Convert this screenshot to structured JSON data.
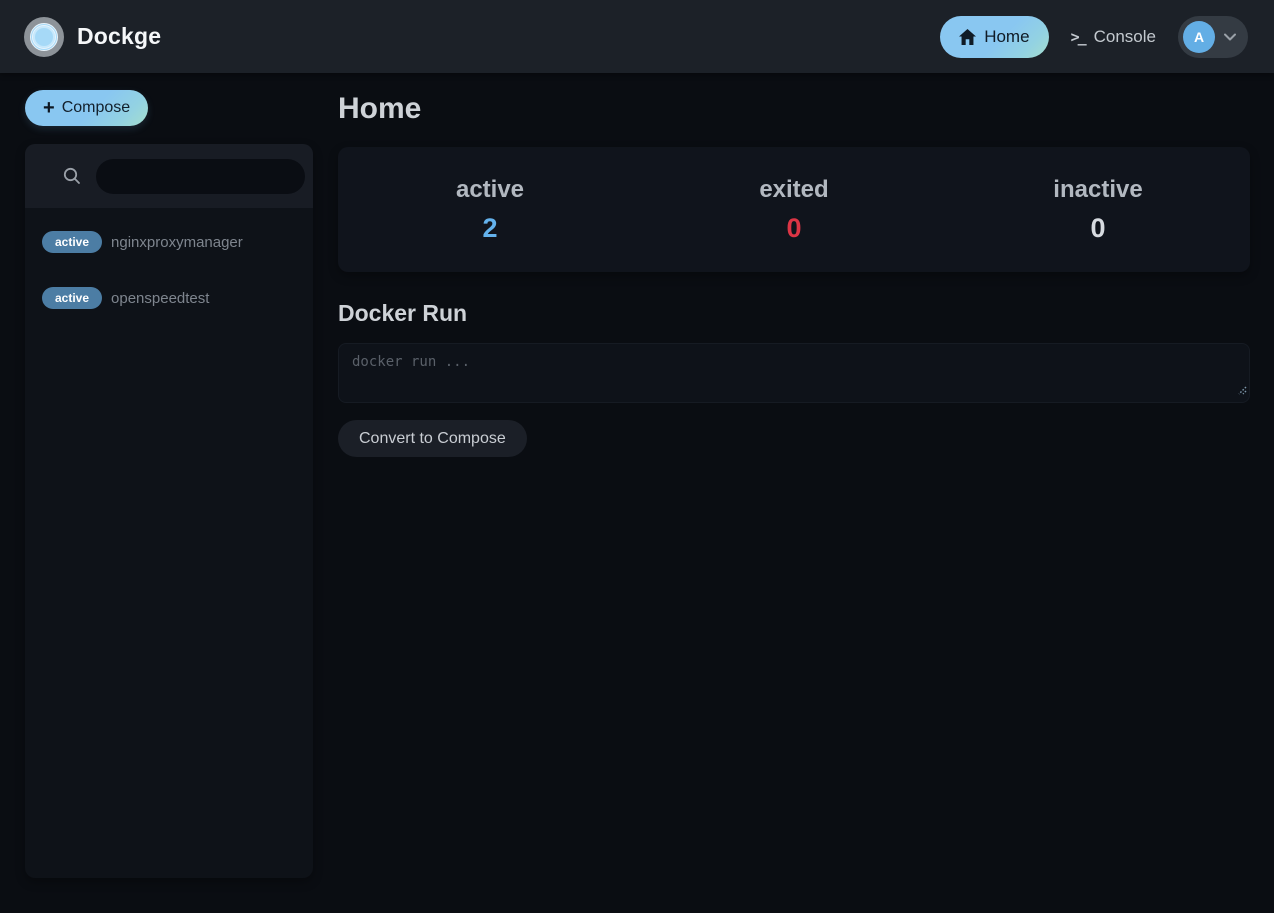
{
  "navbar": {
    "brand": "Dockge",
    "home": {
      "label": "Home"
    },
    "console": {
      "label": "Console",
      "icon_glyph": ">_"
    },
    "avatar": {
      "letter": "A"
    }
  },
  "sidebar": {
    "compose_button": {
      "plus_glyph": "+",
      "label": "Compose"
    },
    "search": {
      "value": "",
      "placeholder": ""
    },
    "stacks": [
      {
        "status": "active",
        "name": "nginxproxymanager"
      },
      {
        "status": "active",
        "name": "openspeedtest"
      }
    ]
  },
  "main": {
    "title": "Home",
    "stats": [
      {
        "label": "active",
        "value": "2",
        "color": "#64b2ec"
      },
      {
        "label": "exited",
        "value": "0",
        "color": "#dc3545"
      },
      {
        "label": "inactive",
        "value": "0",
        "color": "#d7dbe0"
      }
    ],
    "docker_run": {
      "title": "Docker Run",
      "placeholder": "docker run ...",
      "convert_label": "Convert to Compose"
    }
  },
  "colors": {
    "navbar_bg": "#1c2128",
    "page_bg": "#0a0d12",
    "panel_bg": "#0e1218",
    "card_bg": "#10141c",
    "accent_gradient_start": "#89c7f1",
    "accent_gradient_end": "#a5decd",
    "badge_active_bg": "#4c7da4",
    "avatar_bg": "#63aee5"
  }
}
